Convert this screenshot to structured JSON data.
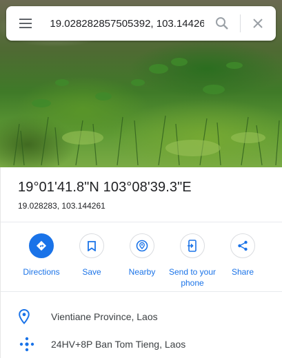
{
  "search": {
    "value": "19.028282857505392, 103.14426",
    "placeholder": ""
  },
  "icons": {
    "menu": "menu-icon",
    "search": "search-icon",
    "close": "close-icon",
    "directions": "directions-icon",
    "save": "bookmark-icon",
    "nearby": "nearby-icon",
    "send": "send-to-phone-icon",
    "share": "share-icon",
    "location": "location-pin-icon",
    "pluscode": "plus-code-icon"
  },
  "place": {
    "title": "19°01'41.8\"N 103°08'39.3\"E",
    "coords": "19.028283, 103.144261"
  },
  "actions": [
    {
      "label": "Directions"
    },
    {
      "label": "Save"
    },
    {
      "label": "Nearby"
    },
    {
      "label": "Send to your phone"
    },
    {
      "label": "Share"
    }
  ],
  "details": {
    "region": "Vientiane Province, Laos",
    "pluscode": "24HV+8P Ban Tom Tieng, Laos"
  },
  "colors": {
    "accent": "#1a73e8",
    "icon_gray": "#5f6368"
  }
}
